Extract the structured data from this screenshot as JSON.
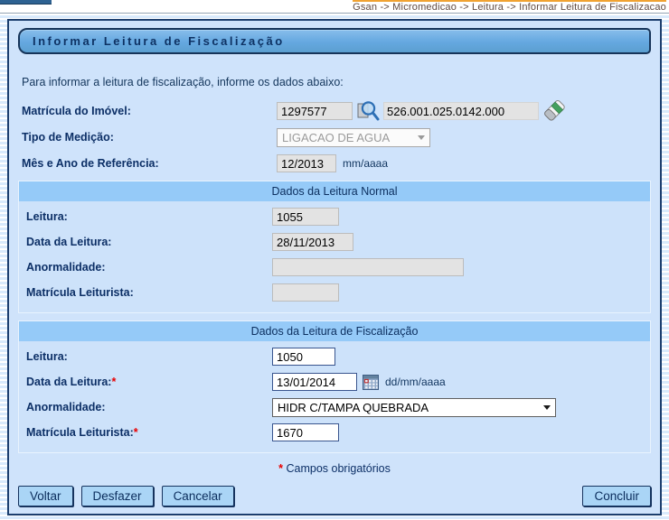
{
  "breadcrumb": "Gsan -> Micromedicao -> Leitura -> Informar Leitura de Fiscalizacao",
  "page_title": "Informar Leitura de Fiscalização",
  "intro": "Para informar a leitura de fiscalização, informe os dados abaixo:",
  "fields": {
    "matricula_imovel": {
      "label": "Matrícula do Imóvel:",
      "value": "1297577",
      "inscricao": "526.001.025.0142.000"
    },
    "tipo_medicao": {
      "label": "Tipo de Medição:",
      "value": "LIGACAO DE AGUA"
    },
    "mes_ano": {
      "label": "Mês e Ano de Referência:",
      "value": "12/2013",
      "hint": "mm/aaaa"
    }
  },
  "leitura_normal": {
    "title": "Dados da Leitura Normal",
    "leitura": {
      "label": "Leitura:",
      "value": "1055"
    },
    "data": {
      "label": "Data da Leitura:",
      "value": "28/11/2013"
    },
    "anormalidade": {
      "label": "Anormalidade:",
      "value": ""
    },
    "matricula": {
      "label": "Matrícula Leiturista:",
      "value": ""
    }
  },
  "leitura_fiscalizacao": {
    "title": "Dados da Leitura de Fiscalização",
    "leitura": {
      "label": "Leitura:",
      "value": "1050"
    },
    "data": {
      "label": "Data da Leitura:",
      "required": "*",
      "value": "13/01/2014",
      "hint": "dd/mm/aaaa"
    },
    "anormalidade": {
      "label": "Anormalidade:",
      "value": "HIDR C/TAMPA QUEBRADA"
    },
    "matricula": {
      "label": "Matrícula Leiturista:",
      "required": "*",
      "value": "1670"
    }
  },
  "required_note": {
    "asterisk": "*",
    "text": "Campos obrigatórios"
  },
  "buttons": {
    "voltar": "Voltar",
    "desfazer": "Desfazer",
    "cancelar": "Cancelar",
    "concluir": "Concluir"
  },
  "icons": {
    "search": "magnifier-over-document",
    "eraser": "green-striped-eraser",
    "calendar": "mini-calendar-grid"
  },
  "colors": {
    "frame_border": "#1c3e6e",
    "main_bg": "#cfe3fb",
    "titlebar_bg": "#6cade3",
    "section_header_bg": "#95caf8",
    "label_text": "#0c2f66",
    "readonly_bg": "#e3e3e3",
    "accent_orange": "#f0a232",
    "required_red": "#e80000",
    "button_bg": "#aad5f6"
  }
}
